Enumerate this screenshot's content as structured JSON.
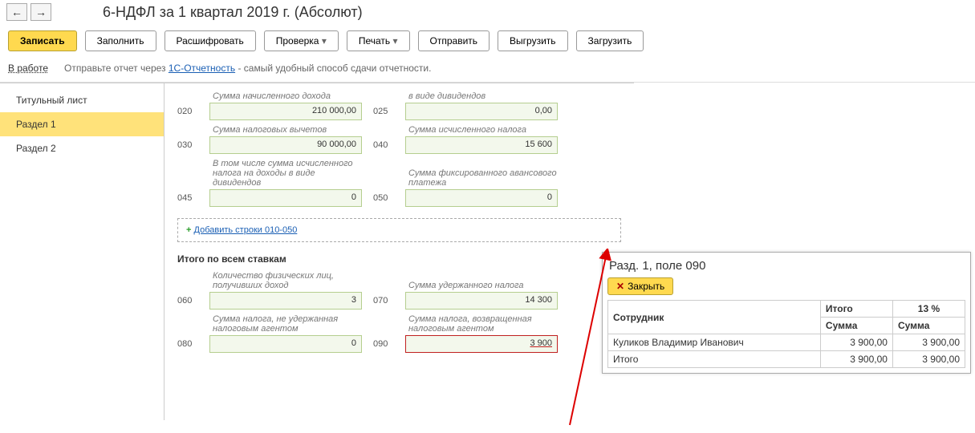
{
  "nav": {
    "back": "←",
    "forward": "→"
  },
  "title": "6-НДФЛ за 1 квартал 2019 г. (Абсолют)",
  "toolbar": {
    "save": "Записать",
    "fill": "Заполнить",
    "decode": "Расшифровать",
    "check": "Проверка",
    "print": "Печать",
    "send": "Отправить",
    "export": "Выгрузить",
    "import": "Загрузить"
  },
  "status": {
    "state": "В работе",
    "info_pre": "Отправьте отчет через ",
    "info_link": "1С-Отчетность",
    "info_post": " - самый удобный способ сдачи отчетности."
  },
  "sidebar": {
    "items": [
      {
        "label": "Титульный лист",
        "active": false
      },
      {
        "label": "Раздел 1",
        "active": true
      },
      {
        "label": "Раздел 2",
        "active": false
      }
    ]
  },
  "fields": {
    "f020": {
      "code": "020",
      "label": "Сумма начисленного дохода",
      "value": "210 000,00"
    },
    "f025": {
      "code": "025",
      "label": "в виде дивидендов",
      "value": "0,00"
    },
    "f030": {
      "code": "030",
      "label": "Сумма налоговых вычетов",
      "value": "90 000,00"
    },
    "f040": {
      "code": "040",
      "label": "Сумма исчисленного налога",
      "value": "15 600"
    },
    "f045": {
      "code": "045",
      "label": "В том числе сумма исчисленного налога на доходы в виде дивидендов",
      "value": "0"
    },
    "f050": {
      "code": "050",
      "label": "Сумма фиксированного авансового платежа",
      "value": "0"
    },
    "add_link": "Добавить строки 010-050",
    "totals_header": "Итого по всем ставкам",
    "f060": {
      "code": "060",
      "label": "Количество физических лиц, получивших доход",
      "value": "3"
    },
    "f070": {
      "code": "070",
      "label": "Сумма удержанного налога",
      "value": "14 300"
    },
    "f080": {
      "code": "080",
      "label": "Сумма налога, не удержанная налоговым агентом",
      "value": "0"
    },
    "f090": {
      "code": "090",
      "label": "Сумма налога, возвращенная налоговым агентом",
      "value": "3 900"
    }
  },
  "popup": {
    "title": "Разд. 1, поле 090",
    "close": "Закрыть",
    "col_employee": "Сотрудник",
    "col_total": "Итого",
    "col_rate": "13 %",
    "col_sum1": "Сумма",
    "col_sum2": "Сумма",
    "rows": [
      {
        "name": "Куликов Владимир Иванович",
        "s1": "3 900,00",
        "s2": "3 900,00"
      }
    ],
    "total_label": "Итого",
    "total_s1": "3 900,00",
    "total_s2": "3 900,00"
  }
}
